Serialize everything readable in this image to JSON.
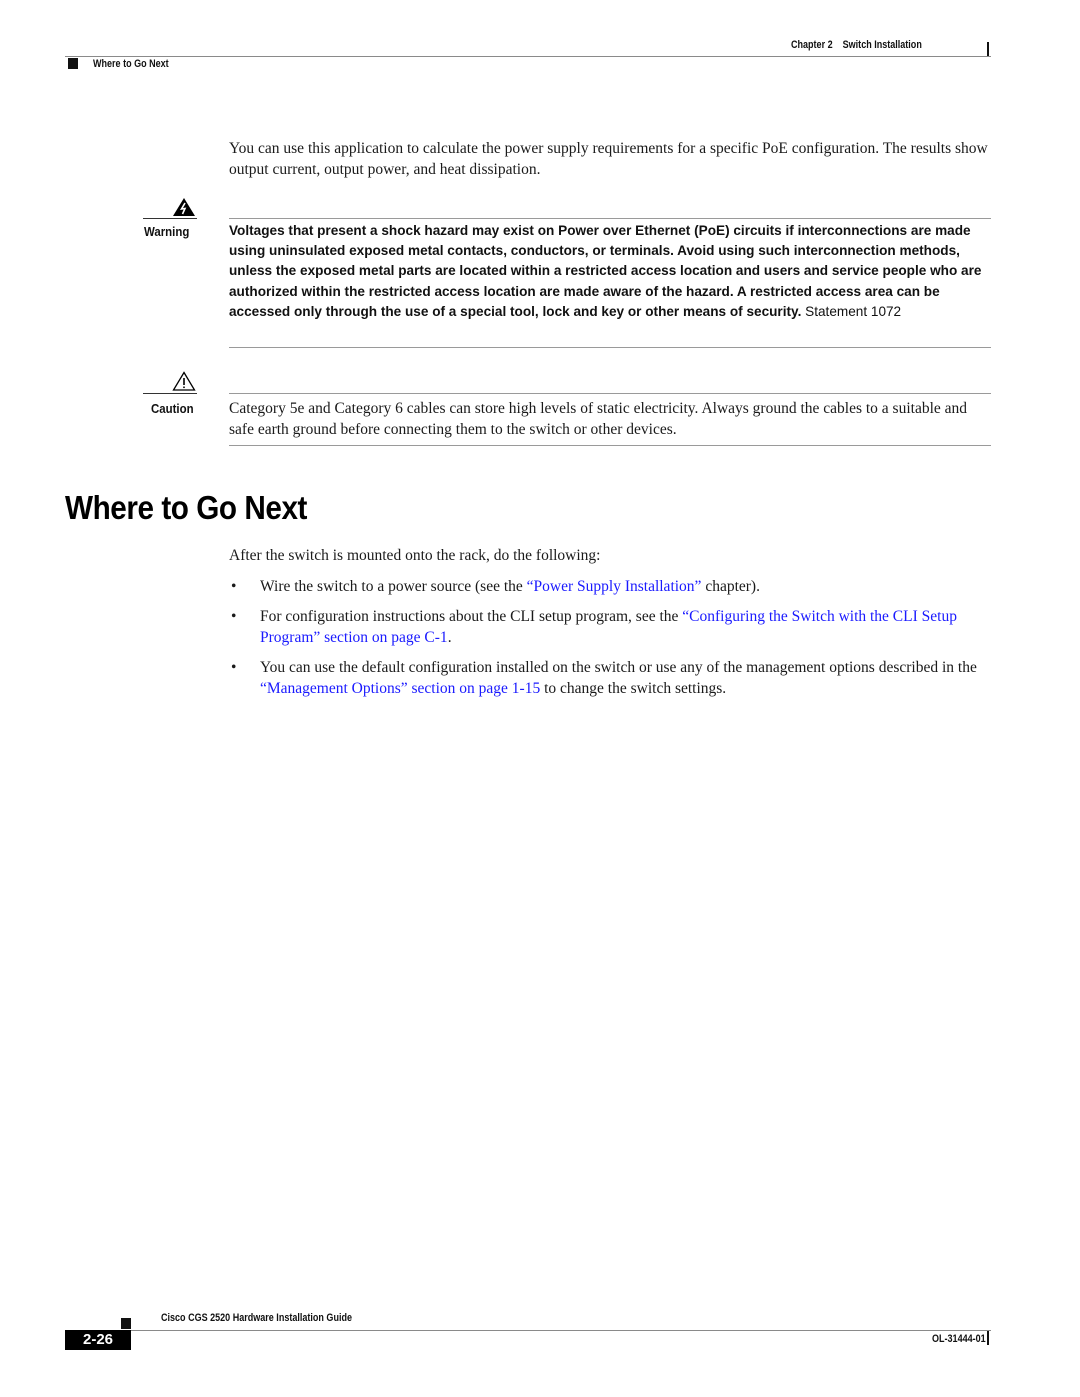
{
  "header": {
    "chapter": "Chapter 2",
    "chapter_title": "Switch Installation",
    "section": "Where to Go Next"
  },
  "intro": "You can use this application to calculate the power supply requirements for a specific PoE configuration. The results show output current, output power, and heat dissipation.",
  "warning": {
    "icon": "warning-shock-icon",
    "label": "Warning",
    "text": "Voltages that present a shock hazard may exist on Power over Ethernet (PoE) circuits if interconnections are made using uninsulated exposed metal contacts, conductors, or terminals. Avoid using such interconnection methods, unless the exposed metal parts are located within a restricted access location and users and service people who are authorized within the restricted access location are made aware of the hazard. A restricted access area can be accessed only through the use of a special tool, lock and key or other means of security.",
    "statement": "Statement 1072"
  },
  "caution": {
    "icon": "caution-triangle-icon",
    "label": "Caution",
    "text": "Category 5e and Category 6 cables can store high levels of static electricity. Always ground the cables to a suitable and safe earth ground before connecting them to the switch or other devices."
  },
  "section": {
    "title": "Where to Go Next",
    "lead": "After the switch is mounted onto the rack, do the following:",
    "bullet_char": "•",
    "bullets": [
      {
        "before": "Wire the switch to a power source (see the ",
        "link": "“Power Supply Installation”",
        "after": " chapter)."
      },
      {
        "before": "For configuration instructions about the CLI setup program, see the ",
        "link": "“Configuring the Switch with the CLI Setup Program” section on page C-1",
        "after": "."
      },
      {
        "before": "You can use the default configuration installed on the switch or use any of the management options described in the ",
        "link": "“Management Options” section on page 1-15",
        "after": " to change the switch settings."
      }
    ]
  },
  "footer": {
    "guide_title": "Cisco CGS 2520 Hardware Installation Guide",
    "page_number": "2-26",
    "doc_id": "OL-31444-01"
  },
  "colors": {
    "link": "#1a1aff",
    "text": "#1a1a1a",
    "rule": "#8a8a8a"
  }
}
